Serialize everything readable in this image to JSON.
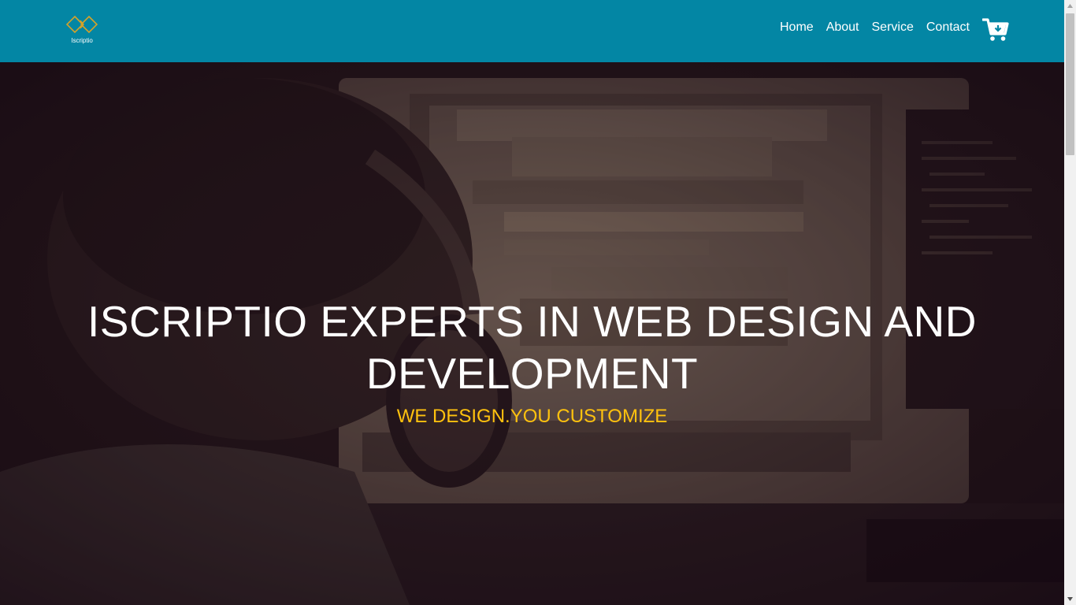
{
  "header": {
    "logo_text": "Iscriptio",
    "logo_icon": "diamond-logo-icon",
    "nav": [
      {
        "label": "Home"
      },
      {
        "label": "About"
      },
      {
        "label": "Service"
      },
      {
        "label": "Contact"
      }
    ],
    "cart_icon": "cart-download-icon"
  },
  "hero": {
    "title": "ISCRIPTIO EXPERTS IN WEB DESIGN AND DEVELOPMENT",
    "subtitle": "WE DESIGN.YOU CUSTOMIZE"
  },
  "colors": {
    "header_bg": "#0386a4",
    "accent": "#ffc20e",
    "logo_gold": "#d4a22a",
    "hero_overlay": "#1f1119"
  }
}
